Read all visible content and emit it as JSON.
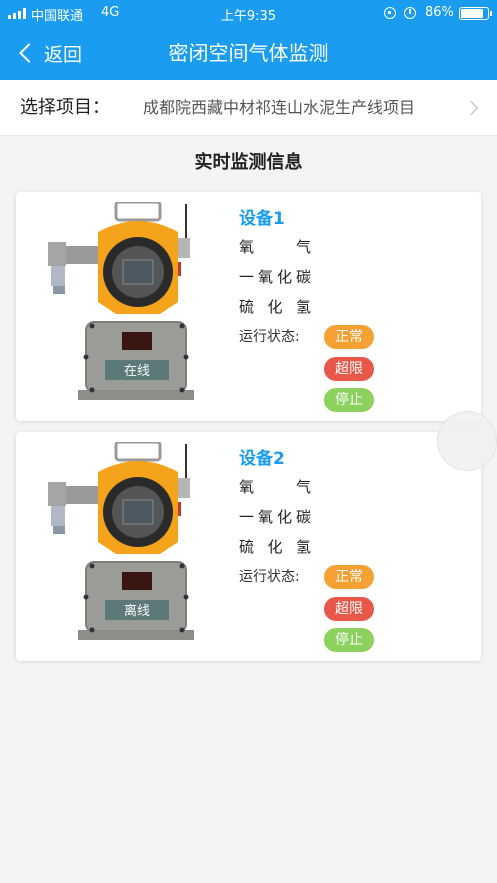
{
  "status_bar": {
    "carrier": "中国联通",
    "network": "4G",
    "time": "上午9:35",
    "battery_pct": "86%",
    "battery_level": 0.86
  },
  "nav": {
    "back_label": "返回",
    "title": "密闭空间气体监测"
  },
  "project": {
    "label": "选择项目：",
    "value": "成都院西藏中材祁连山水泥生产线项目"
  },
  "section_title": "实时监测信息",
  "colors": {
    "header_blue": "#1a9cf0",
    "normal": "#f5a033",
    "over_limit": "#e8584a",
    "stopped": "#8bd15c"
  },
  "devices": [
    {
      "name": "设备1",
      "gases": [
        "氧 气",
        "一氧化碳",
        "硫 化 氢"
      ],
      "status_label": "运行状态:",
      "badges": {
        "normal": "正常",
        "over": "超限",
        "stop": "停止"
      },
      "connection": "在线"
    },
    {
      "name": "设备2",
      "gases": [
        "氧 气",
        "一氧化碳",
        "硫 化 氢"
      ],
      "status_label": "运行状态:",
      "badges": {
        "normal": "正常",
        "over": "超限",
        "stop": "停止"
      },
      "connection": "离线"
    }
  ]
}
